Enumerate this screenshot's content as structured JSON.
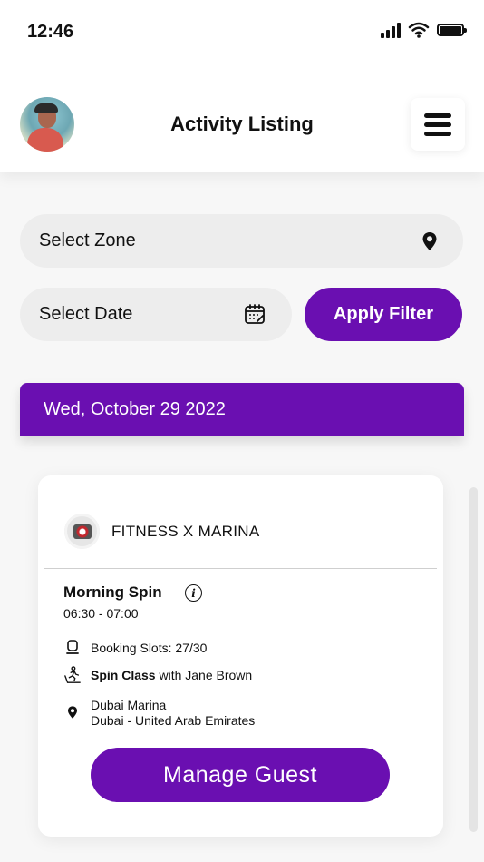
{
  "status_bar": {
    "time": "12:46",
    "icons": [
      "signal-icon",
      "wifi-icon",
      "battery-icon"
    ]
  },
  "header": {
    "title": "Activity Listing",
    "avatar": "avatar",
    "menu_icon": "hamburger-menu-icon"
  },
  "filters": {
    "zone_placeholder": "Select Zone",
    "date_placeholder": "Select Date",
    "apply_label": "Apply Filter",
    "zone_icon": "location-pin-icon",
    "date_icon": "calendar-icon"
  },
  "date_banner": "Wed, October 29 2022",
  "activity": {
    "gym_name": "FITNESS X MARINA",
    "title": "Morning Spin",
    "time": "06:30 - 07:00",
    "booking_slots": "Booking Slots: 27/30",
    "class_name": "Spin Class",
    "instructor": "with Jane Brown",
    "location_line1": "Dubai Marina",
    "location_line2": "Dubai - United Arab Emirates",
    "manage_label": "Manage Guest"
  },
  "colors": {
    "accent": "#6a0fb1",
    "field_bg": "#ededed"
  }
}
